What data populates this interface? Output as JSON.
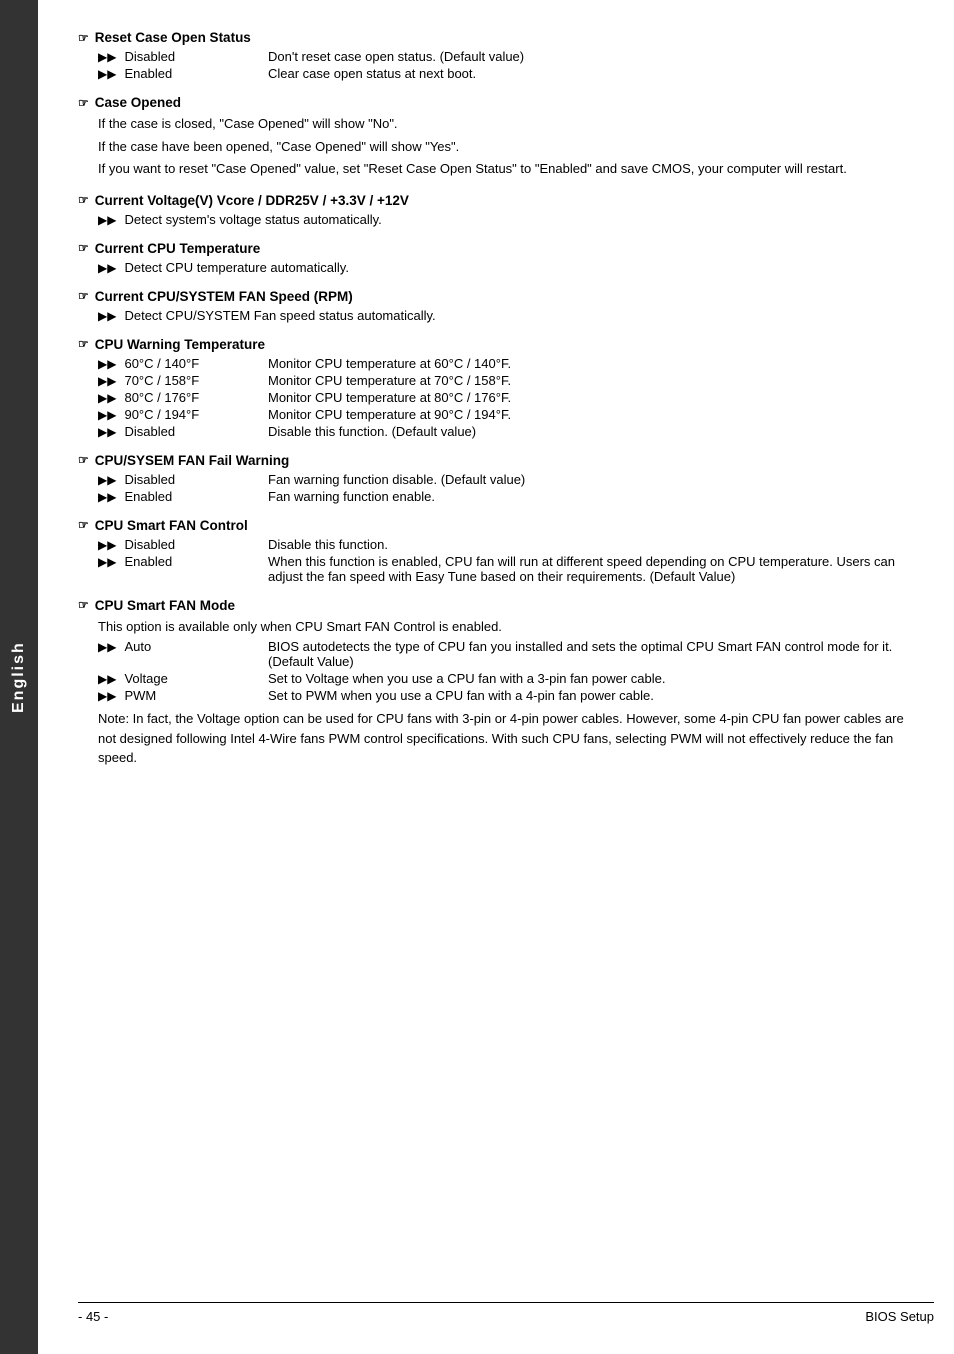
{
  "sidebar": {
    "label": "English"
  },
  "sections": [
    {
      "id": "reset-case-open-status",
      "title": "Reset Case Open Status",
      "items": [
        {
          "key": "Disabled",
          "value": "Don't reset case open status. (Default value)"
        },
        {
          "key": "Enabled",
          "value": "Clear case open status at next boot."
        }
      ],
      "paragraphs": []
    },
    {
      "id": "case-opened",
      "title": "Case Opened",
      "items": [],
      "paragraphs": [
        "If the case is closed, \"Case Opened\" will show \"No\".",
        "If the case have been opened, \"Case Opened\" will show \"Yes\".",
        "If you want to reset \"Case Opened\" value, set \"Reset Case Open Status\" to \"Enabled\" and save CMOS, your computer will restart."
      ]
    },
    {
      "id": "current-voltage",
      "title": "Current Voltage(V) Vcore / DDR25V / +3.3V / +12V",
      "items": [
        {
          "key": "",
          "value": "Detect system's voltage status automatically."
        }
      ],
      "paragraphs": []
    },
    {
      "id": "current-cpu-temp",
      "title": "Current CPU Temperature",
      "items": [
        {
          "key": "",
          "value": "Detect CPU temperature automatically."
        }
      ],
      "paragraphs": []
    },
    {
      "id": "current-cpu-fan-speed",
      "title": "Current CPU/SYSTEM FAN Speed (RPM)",
      "items": [
        {
          "key": "",
          "value": "Detect CPU/SYSTEM Fan speed status automatically."
        }
      ],
      "paragraphs": []
    },
    {
      "id": "cpu-warning-temperature",
      "title": "CPU Warning Temperature",
      "items": [
        {
          "key": "60°C / 140°F",
          "value": "Monitor CPU temperature at 60°C / 140°F."
        },
        {
          "key": "70°C / 158°F",
          "value": "Monitor CPU temperature at 70°C / 158°F."
        },
        {
          "key": "80°C / 176°F",
          "value": "Monitor CPU temperature at 80°C / 176°F."
        },
        {
          "key": "90°C / 194°F",
          "value": "Monitor CPU temperature at 90°C / 194°F."
        },
        {
          "key": "Disabled",
          "value": "Disable this function. (Default value)"
        }
      ],
      "paragraphs": []
    },
    {
      "id": "cpu-sysem-fan-fail-warning",
      "title": "CPU/SYSEM FAN Fail Warning",
      "items": [
        {
          "key": "Disabled",
          "value": "Fan warning function disable. (Default value)"
        },
        {
          "key": "Enabled",
          "value": "Fan warning function enable."
        }
      ],
      "paragraphs": []
    },
    {
      "id": "cpu-smart-fan-control",
      "title": "CPU Smart FAN Control",
      "items": [
        {
          "key": "Disabled",
          "value": "Disable this function."
        },
        {
          "key": "Enabled",
          "value": "When this function is enabled, CPU fan will run at different speed depending on CPU temperature. Users can adjust the fan speed with Easy Tune based on their requirements. (Default Value)"
        }
      ],
      "paragraphs": []
    },
    {
      "id": "cpu-smart-fan-mode",
      "title": "CPU Smart FAN Mode",
      "items": [],
      "intro": "This option is available only when CPU Smart FAN Control is enabled.",
      "mode_items": [
        {
          "key": "Auto",
          "value": "BIOS autodetects the type of CPU fan you installed and sets the optimal CPU Smart FAN control mode for it. (Default Value)"
        },
        {
          "key": "Voltage",
          "value": "Set to Voltage when you use a CPU fan with a 3-pin fan power cable."
        },
        {
          "key": "PWM",
          "value": "Set to PWM when you use a CPU fan with a 4-pin fan power cable."
        }
      ],
      "note": "Note: In fact, the Voltage option can be used for CPU fans with 3-pin or 4-pin power cables. However, some 4-pin CPU fan power cables are not designed following Intel 4-Wire fans PWM control specifications. With such CPU fans, selecting PWM will not effectively reduce the fan speed.",
      "paragraphs": []
    }
  ],
  "footer": {
    "page": "- 45 -",
    "label": "BIOS Setup"
  }
}
